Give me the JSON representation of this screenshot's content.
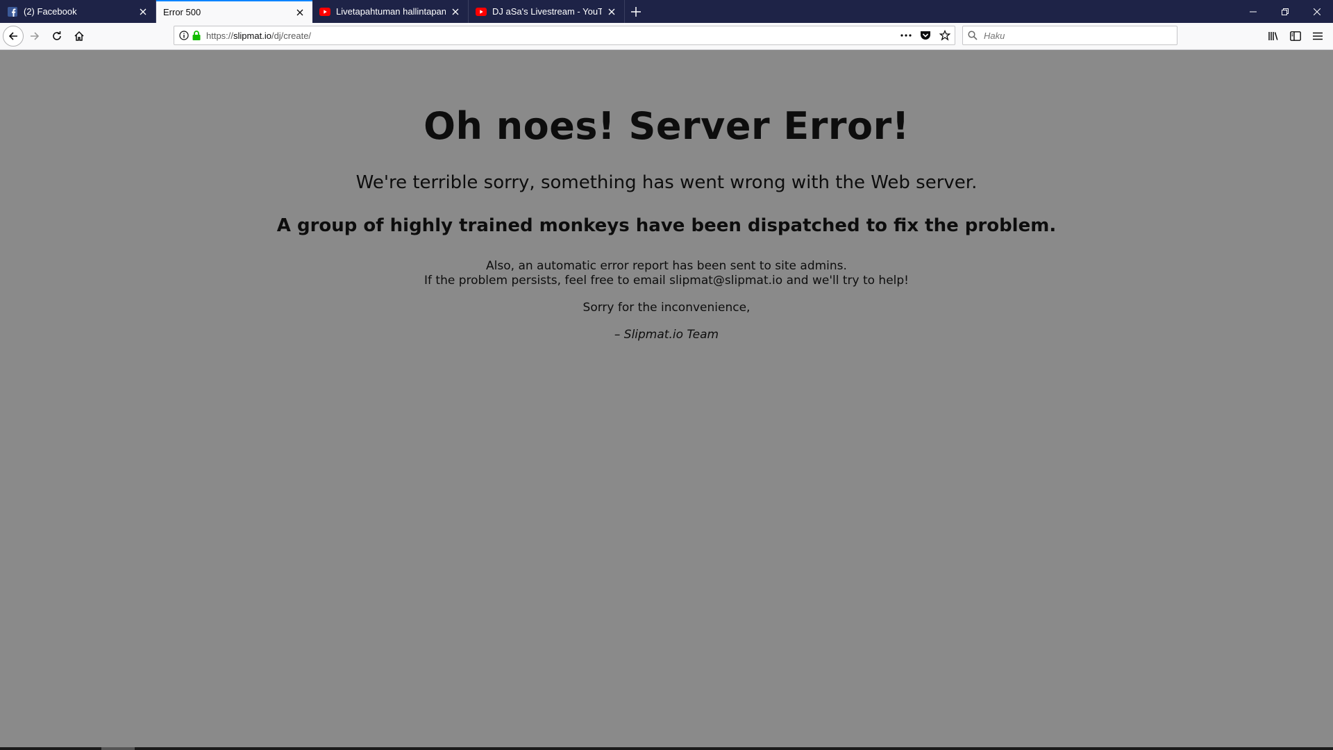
{
  "browser": {
    "tabs": [
      {
        "title": "(2) Facebook",
        "icon": "facebook-icon",
        "active": false
      },
      {
        "title": "Error 500",
        "icon": "",
        "active": true
      },
      {
        "title": "Livetapahtuman hallintapaneel",
        "icon": "youtube-icon",
        "active": false
      },
      {
        "title": "DJ aSa's Livestream - YouTube",
        "icon": "youtube-icon",
        "active": false
      }
    ],
    "url": {
      "scheme": "https://",
      "host": "slipmat.io",
      "path": "/dj/create/"
    },
    "search_placeholder": "Haku",
    "colors": {
      "titlebar": "#1e2347",
      "active_tab_accent": "#0a84ff",
      "secure_lock": "#12bc00",
      "youtube_red": "#ff0000",
      "facebook_blue": "#3b5998"
    }
  },
  "page": {
    "heading": "Oh noes! Server Error!",
    "sorry_text": "We're terrible sorry, something has went wrong with the Web server.",
    "monkeys_text": "A group of highly trained monkeys have been dispatched to fix the problem.",
    "report_line1": "Also, an automatic error report has been sent to site admins.",
    "report_line2": "If the problem persists, feel free to email slipmat@slipmat.io and we'll try to help!",
    "apology": "Sorry for the inconvenience,",
    "signature": "– Slipmat.io Team",
    "background_color": "#8a8a8a"
  }
}
